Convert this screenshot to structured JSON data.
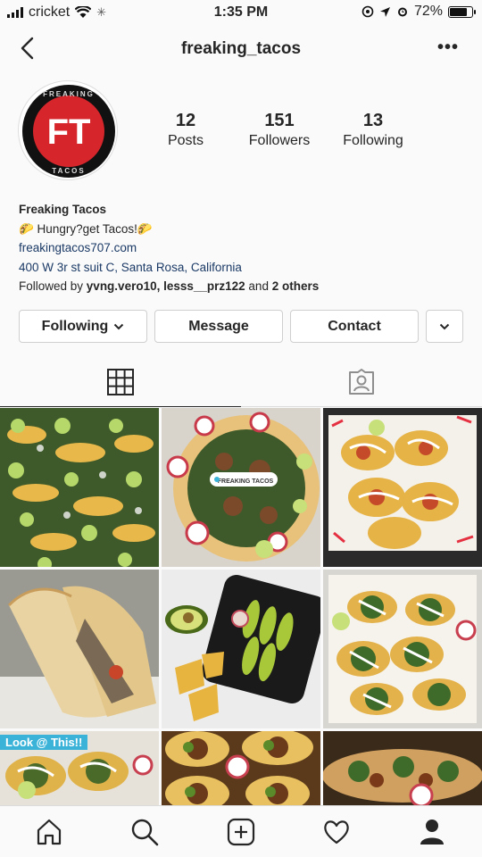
{
  "status": {
    "carrier": "cricket",
    "time": "1:35 PM",
    "battery": "72%",
    "battery_level": 0.72
  },
  "header": {
    "username": "freaking_tacos",
    "more": "•••"
  },
  "profile": {
    "avatar_text": "FT",
    "avatar_ring_top": "FREAKING",
    "avatar_ring_bottom": "TACOS",
    "stats": [
      {
        "num": "12",
        "label": "Posts"
      },
      {
        "num": "151",
        "label": "Followers"
      },
      {
        "num": "13",
        "label": "Following"
      }
    ]
  },
  "bio": {
    "name": "Freaking Tacos",
    "tagline": "🌮 Hungry?get Tacos!🌮",
    "website": "freakingtacos707.com",
    "address": "400 W 3r st suit C, Santa Rosa, California",
    "followed_prefix": "Followed by ",
    "followed_users": "yvng.vero10, lesss__prz122",
    "followed_and": " and ",
    "followed_others": "2 others"
  },
  "buttons": {
    "following": "Following",
    "message": "Message",
    "contact": "Contact"
  },
  "posts": {
    "label_7": "Look @ This!!",
    "label_2": "FREAKING TACOS"
  },
  "colors": {
    "accent_red": "#d7262b",
    "link": "#1b3a66",
    "label_blue": "#3bb3d8"
  }
}
